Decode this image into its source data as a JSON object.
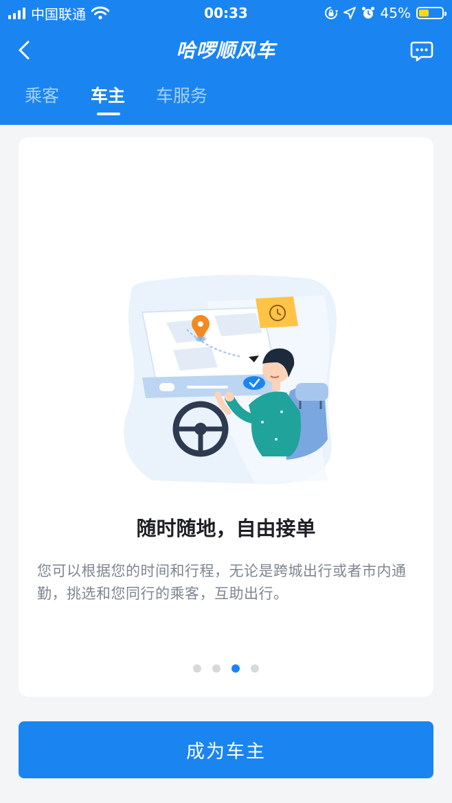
{
  "status_bar": {
    "carrier": "中国联通",
    "time": "00:33",
    "battery_percent": "45%",
    "battery_level": 0.45
  },
  "nav": {
    "title": "哈啰顺风车"
  },
  "tabs": [
    {
      "label": "乘客",
      "active": false
    },
    {
      "label": "车主",
      "active": true
    },
    {
      "label": "车服务",
      "active": false
    }
  ],
  "card": {
    "title": "随时随地，自由接单",
    "description": "您可以根据您的时间和行程，无论是跨城出行或者市内通勤，挑选和您同行的乘客，互助出行。",
    "pagination": {
      "total": 4,
      "current": 3
    }
  },
  "cta": {
    "label": "成为车主"
  },
  "colors": {
    "brand_blue": "#1a85f0",
    "pin_orange": "#f5891f",
    "clock_yellow": "#ffc445",
    "jacket_teal": "#1fa39b"
  },
  "icons": [
    "signal-icon",
    "wifi-icon",
    "lock-rotation-icon",
    "location-arrow-icon",
    "alarm-icon",
    "battery-icon",
    "back-icon",
    "message-icon"
  ]
}
